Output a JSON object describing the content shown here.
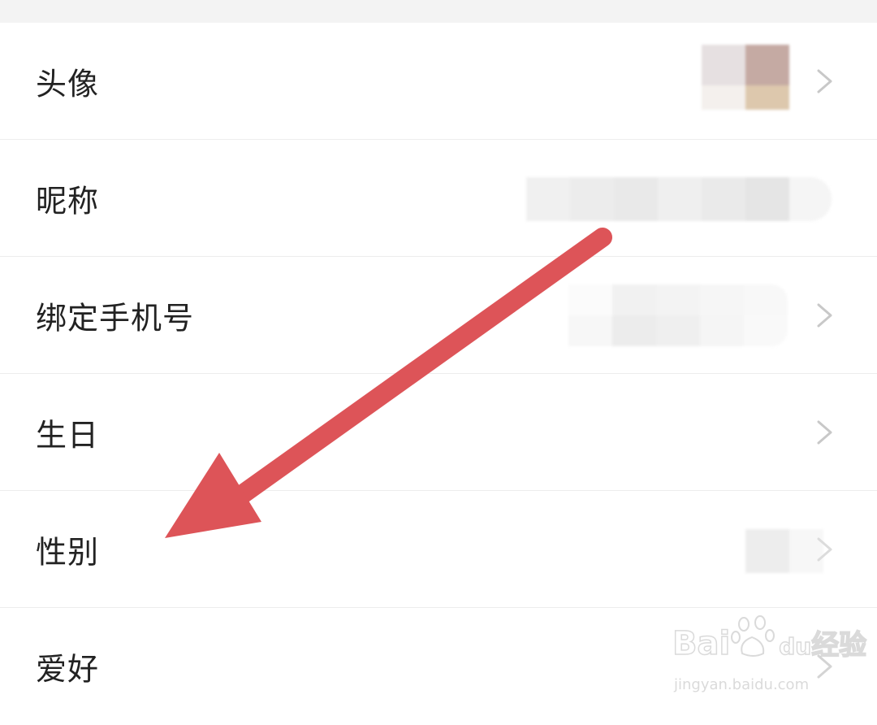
{
  "profile_rows": [
    {
      "label": "头像",
      "chevron": true
    },
    {
      "label": "昵称",
      "chevron": false
    },
    {
      "label": "绑定手机号",
      "chevron": true
    },
    {
      "label": "生日",
      "chevron": true
    },
    {
      "label": "性别",
      "chevron": true
    },
    {
      "label": "爱好",
      "chevron": true
    }
  ],
  "annotation": {
    "arrow_color": "#dd5458",
    "points_to": "性别"
  },
  "watermark": {
    "brand_prefix": "Bai",
    "brand_suffix": "du",
    "product": "经验",
    "url": "jingyan.baidu.com"
  },
  "colors": {
    "background": "#ffffff",
    "top_strip": "#f3f3f3",
    "divider": "#ededed",
    "label_text": "#222222",
    "chevron": "#c8c8c8"
  }
}
